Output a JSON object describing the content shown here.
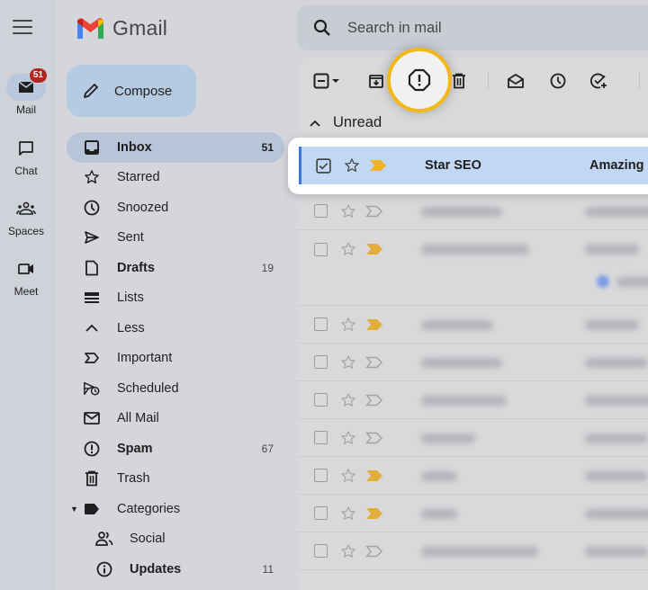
{
  "app": {
    "name": "Gmail"
  },
  "rail": {
    "items": [
      {
        "label": "Mail",
        "icon": "mail-icon",
        "badge": "51",
        "active": true
      },
      {
        "label": "Chat",
        "icon": "chat-icon"
      },
      {
        "label": "Spaces",
        "icon": "spaces-icon"
      },
      {
        "label": "Meet",
        "icon": "meet-icon"
      }
    ]
  },
  "compose": {
    "label": "Compose"
  },
  "search": {
    "placeholder": "Search in mail"
  },
  "nav": {
    "items": [
      {
        "label": "Inbox",
        "count": "51",
        "icon": "inbox-icon",
        "active": true,
        "bold": true
      },
      {
        "label": "Starred",
        "count": "",
        "icon": "star-icon"
      },
      {
        "label": "Snoozed",
        "count": "",
        "icon": "clock-icon"
      },
      {
        "label": "Sent",
        "count": "",
        "icon": "send-icon"
      },
      {
        "label": "Drafts",
        "count": "19",
        "icon": "draft-icon",
        "bold": true
      },
      {
        "label": "Lists",
        "count": "",
        "icon": "lists-icon"
      },
      {
        "label": "Less",
        "count": "",
        "icon": "chevron-up-icon"
      },
      {
        "label": "Important",
        "count": "",
        "icon": "important-icon"
      },
      {
        "label": "Scheduled",
        "count": "",
        "icon": "scheduled-icon"
      },
      {
        "label": "All Mail",
        "count": "",
        "icon": "all-mail-icon"
      },
      {
        "label": "Spam",
        "count": "67",
        "icon": "spam-icon",
        "bold": true
      },
      {
        "label": "Trash",
        "count": "",
        "icon": "trash-icon"
      },
      {
        "label": "Categories",
        "count": "",
        "icon": "label-icon"
      },
      {
        "label": "Social",
        "count": "",
        "icon": "social-icon",
        "sub": true
      },
      {
        "label": "Updates",
        "count": "11",
        "icon": "info-icon",
        "sub": true,
        "bold": true
      }
    ]
  },
  "toolbar": {
    "buttons": [
      "select-all",
      "archive",
      "report-spam",
      "delete",
      "mark-as-read",
      "snooze",
      "add-to-tasks"
    ],
    "highlighted": "report-spam",
    "highlight_color": "#f2b81a"
  },
  "section": {
    "label": "Unread"
  },
  "highlighted_email": {
    "sender": "Star SEO",
    "subject": "Amazing",
    "selected": true,
    "important": true
  },
  "emails": [
    {
      "important": false,
      "blurred": true
    },
    {
      "important": false,
      "blurred": true
    },
    {
      "important": true,
      "blurred": true,
      "has_attachment_chip": true
    },
    {
      "important": true,
      "blurred": true
    },
    {
      "important": false,
      "blurred": true
    },
    {
      "important": false,
      "blurred": true
    },
    {
      "important": false,
      "blurred": true
    },
    {
      "important": true,
      "blurred": true
    },
    {
      "important": true,
      "blurred": true
    },
    {
      "important": false,
      "blurred": true
    }
  ]
}
